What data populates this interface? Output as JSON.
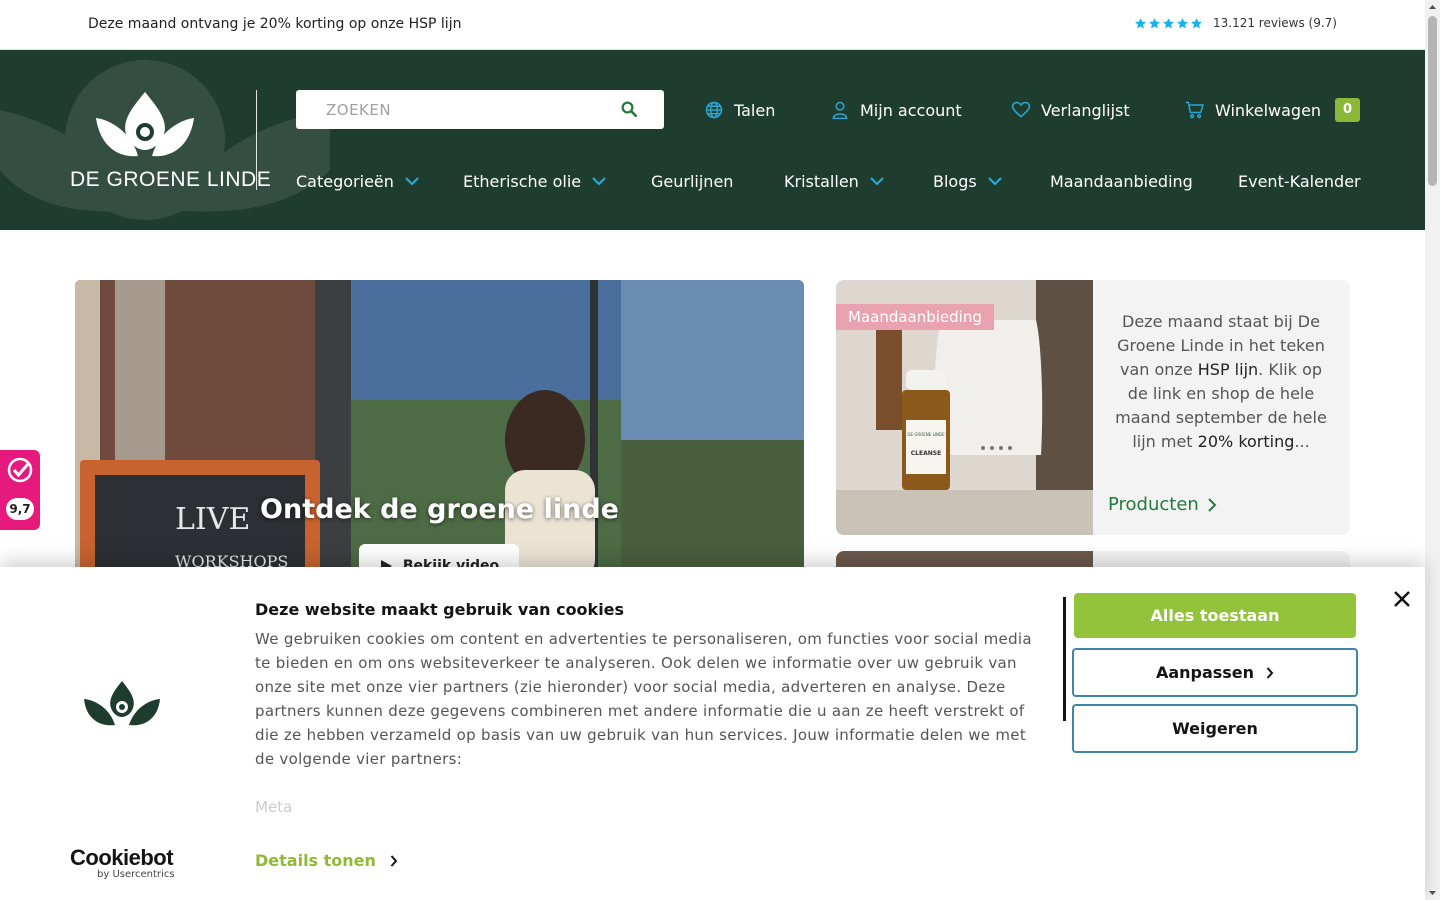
{
  "topbar": {
    "promo": "Deze maand ontvang je 20% korting op onze HSP lijn",
    "reviews": "13.121 reviews (9.7)",
    "star_color": "#1ab2e8"
  },
  "brand": {
    "name": "DE GROENE LINDE",
    "header_bg": "#1f3d2e",
    "accent": "#2aa7d4"
  },
  "search": {
    "placeholder": "ZOEKEN"
  },
  "header_nav": {
    "languages": "Talen",
    "account": "Mijn account",
    "wishlist": "Verlanglijst",
    "cart": "Winkelwagen",
    "cart_count": "0"
  },
  "main_nav": {
    "categories": "Categorieën",
    "essential_oil": "Etherische olie",
    "scent_lines": "Geurlijnen",
    "crystals": "Kristallen",
    "blogs": "Blogs",
    "monthly_offer": "Maandaanbieding",
    "event_calendar": "Event-Kalender"
  },
  "hero": {
    "title": "Ontdek de groene linde",
    "button": "Bekijk video",
    "sign_text": "LIVE",
    "sign_text2": "WORKSHOPS"
  },
  "promo": {
    "tag": "Maandaanbieding",
    "text_1": "Deze maand staat bij De Groene Linde in het teken van onze ",
    "highlight_1": "HSP lijn",
    "text_2": ". Klik op de link en shop de hele maand september de hele lijn met ",
    "highlight_2": "20% korting",
    "text_3": "...",
    "link": "Producten",
    "bottle_label": "CLEANSE",
    "bottle_brand": "DE GROENE LINDE"
  },
  "kiyoh": {
    "score": "9,7"
  },
  "cookie": {
    "title": "Deze website maakt gebruik van cookies",
    "body": "We gebruiken cookies om content en advertenties te personaliseren, om functies voor social media te bieden en om ons websiteverkeer te analyseren. Ook delen we informatie over uw gebruik van onze site met onze vier partners (zie hieronder) voor social media, adverteren en analyse. Deze partners kunnen deze gegevens combineren met andere informatie die u aan ze heeft verstrekt of die ze hebben verzameld op basis van uw gebruik van hun services. Jouw informatie delen we met de volgende vier partners:",
    "partner_1": "Meta",
    "allow_all": "Alles toestaan",
    "customize": "Aanpassen",
    "deny": "Weigeren",
    "details": "Details tonen",
    "cookiebot": "Cookiebot",
    "cookiebot_sub": "by Usercentrics",
    "allow_color": "#92c33b",
    "outline_color": "#3e86a8"
  }
}
